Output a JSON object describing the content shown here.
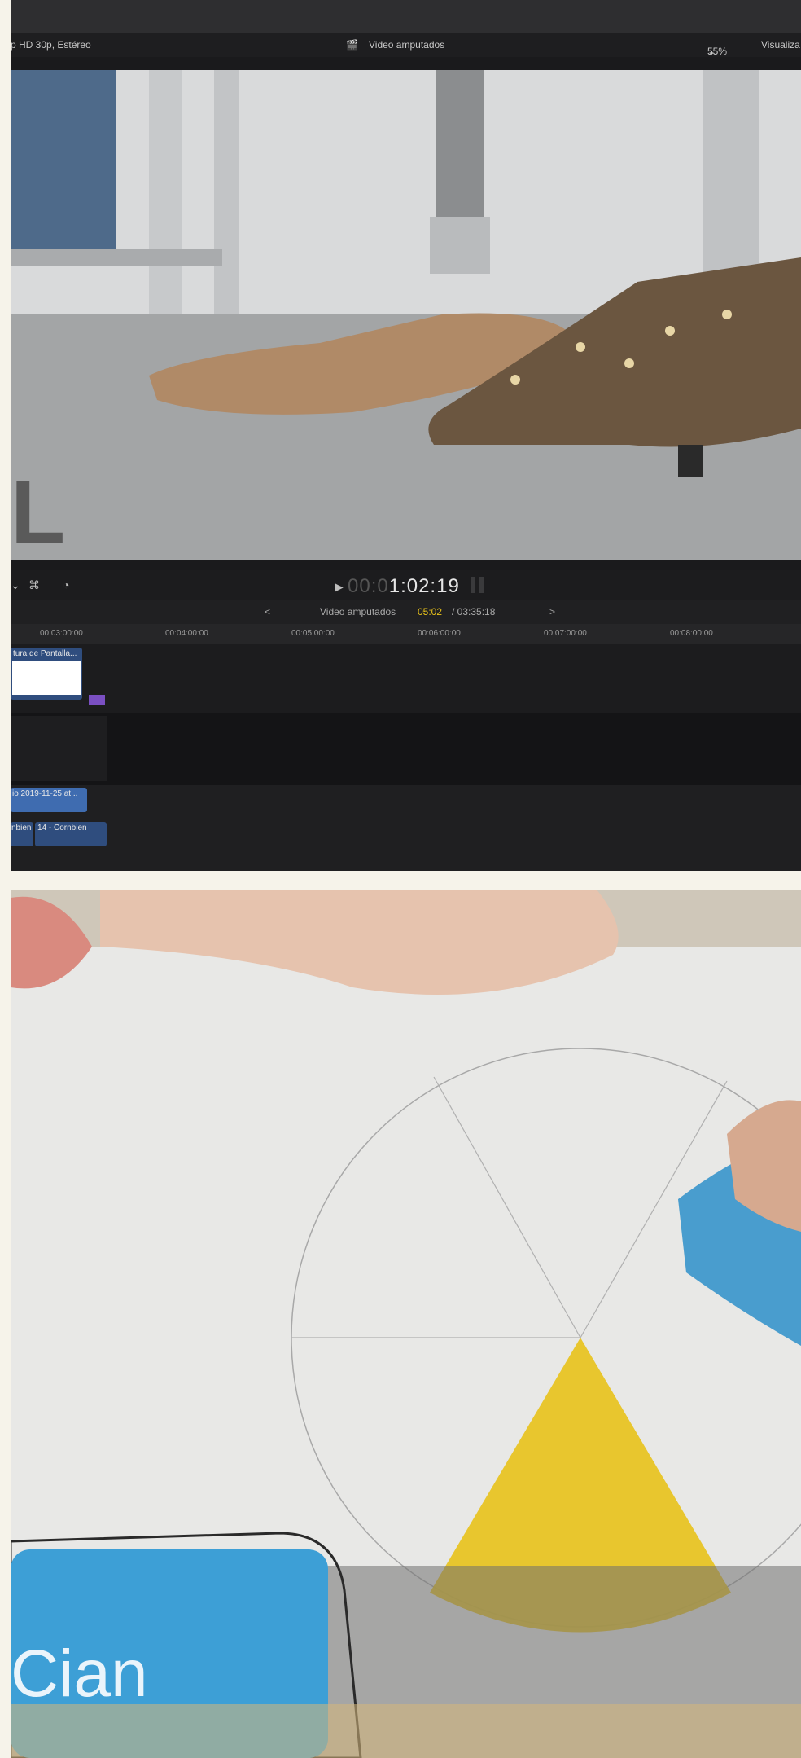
{
  "app": {
    "format_label": "p HD 30p, Estéreo",
    "project_label": "Video amputados",
    "zoom_label": "55%",
    "view_menu_label": "Visualiza"
  },
  "transport": {
    "timecode_dim": "00:0",
    "timecode_main": "1:02:19"
  },
  "timeline": {
    "project_name": "Video amputados",
    "position": "05:02",
    "duration": "/ 03:35:18",
    "ruler_ticks": [
      "00:03:00:00",
      "00:04:00:00",
      "00:05:00:00",
      "00:06:00:00",
      "00:07:00:00",
      "00:08:00:00"
    ],
    "clips": {
      "screen_capture": "tura de Pantalla...",
      "recording": "io 2019-11-25 at...",
      "audio_a": "nbien",
      "audio_b": "14 - Cornbien"
    }
  },
  "viewer_overlay": {
    "partial_letter": "L"
  },
  "second_frame": {
    "caption": "Cian"
  },
  "colors": {
    "accent_yellow": "#e8c21a",
    "clip_blue": "#2f4d7e",
    "caption_blue": "#3d9fd6",
    "clip_purple": "#7a4fc2"
  }
}
